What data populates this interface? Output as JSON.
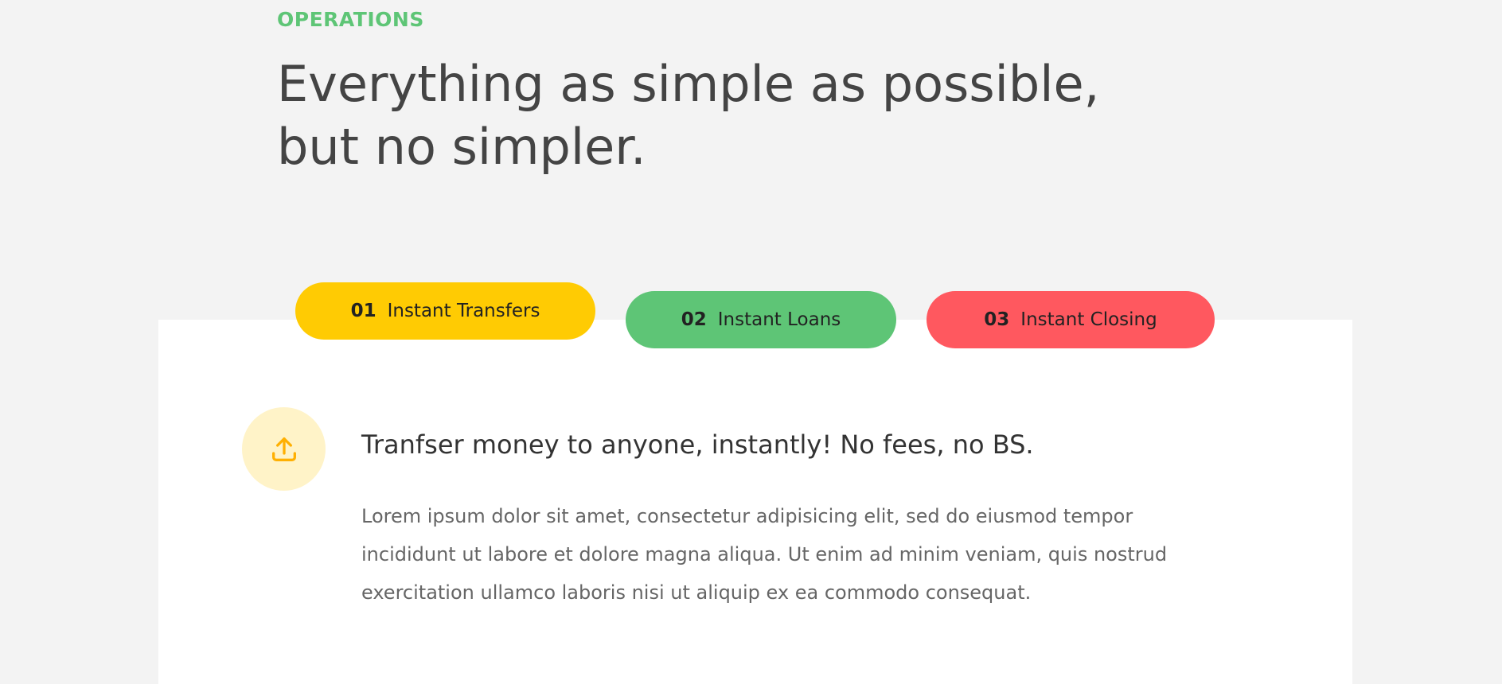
{
  "section": {
    "label": "OPERATIONS",
    "title": "Everything as simple as possible, but no simpler."
  },
  "tabs": [
    {
      "number": "01",
      "label": "Instant Transfers",
      "color": "#ffcb03",
      "active": true
    },
    {
      "number": "02",
      "label": "Instant Loans",
      "color": "#5ec576",
      "active": false
    },
    {
      "number": "03",
      "label": "Instant Closing",
      "color": "#ff585f",
      "active": false
    }
  ],
  "content": {
    "icon": "upload-icon",
    "icon_color": "#ffb003",
    "heading": "Tranfser money to anyone, instantly! No fees, no BS.",
    "text": "Lorem ipsum dolor sit amet, consectetur adipisicing elit, sed do eiusmod tempor incididunt ut labore et dolore magna aliqua. Ut enim ad minim veniam, quis nostrud exercitation ullamco laboris nisi ut aliquip ex ea commodo consequat."
  },
  "colors": {
    "background": "#f3f3f3",
    "accent_green": "#5ec576",
    "title_text": "#444444"
  }
}
